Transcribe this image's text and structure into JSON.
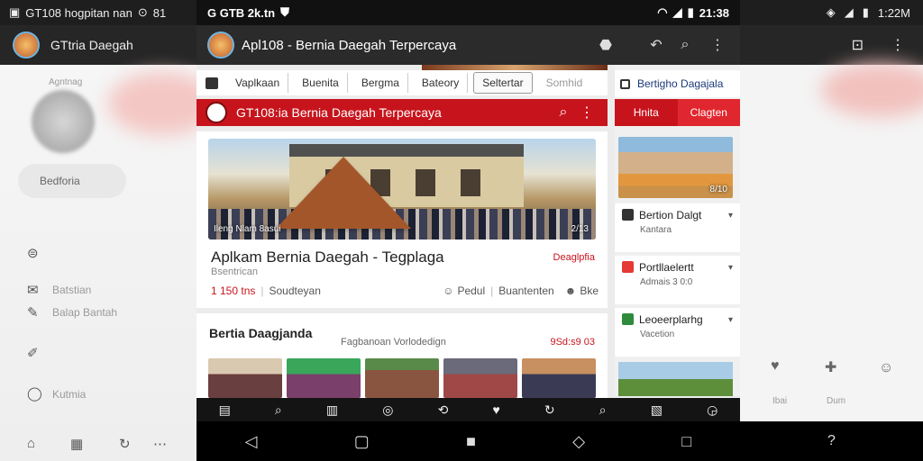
{
  "left_panel": {
    "status_text": "GT108 hogpitan nan",
    "status_right": "81",
    "app_title": "GTtria Daegah",
    "profile_label": "Agntnag",
    "button_label": "Bedforia",
    "menu": [
      "Batstian",
      "Balap Bantah",
      "Kutmia"
    ],
    "bottom_icons": [
      "home-icon",
      "image-icon",
      "refresh-icon",
      "more-icon"
    ]
  },
  "main": {
    "status": {
      "left": "G GTB 2k.tn",
      "time": "21:38"
    },
    "appbar": {
      "title": "Apl108 - Bernia Daegah Terpercaya"
    },
    "chips": [
      "Vaplkaan",
      "Buenita",
      "Bergma",
      "Bateory",
      "Seltertar",
      "Somhid"
    ],
    "selected_chip": "Seltertar",
    "redbar": {
      "title": "GT108:ia Bernia Daegah Terpercaya"
    },
    "hero": {
      "caption": "Ileng Nlam 8asui",
      "counter": "2/13"
    },
    "article": {
      "title": "Aplkam Bernia Daegah - Tegplaga",
      "tag": "Deaglpfia",
      "subtitle": "Bsentrican",
      "count": "1 150 tns",
      "source": "Soudteyan",
      "action1": "Pedul",
      "action2": "Buantenten",
      "action3": "Bke"
    },
    "section": {
      "title": "Bertia Daagjanda",
      "caption": "Fagbanoan Vorlodedign",
      "right": "9Sd:s9 03"
    },
    "bottom_bar_icons": [
      "layout-icon",
      "search-icon",
      "book-icon",
      "target-icon",
      "tag-icon",
      "heart-icon",
      "refresh-icon",
      "search-icon",
      "grid-icon",
      "chat-icon"
    ],
    "nav_icons": [
      "back-icon",
      "home-icon",
      "square-icon",
      "back-icon",
      "recent-icon"
    ]
  },
  "right_panel": {
    "header": "Bertigho Dagajala",
    "tabs": [
      "Hnita",
      "Clagten"
    ],
    "tab_colors": [
      "#c7141c",
      "#e0262e"
    ],
    "img_counter": "8/10",
    "items": [
      {
        "title": "Bertion Dalgt",
        "sub": "Kantara",
        "color": "#333333"
      },
      {
        "title": "Portllaelertt",
        "sub": "Admais 3 0:0",
        "color": "#e53935"
      },
      {
        "title": "Leoeerplarhg",
        "sub": "Vacetion",
        "color": "#2e8b3b"
      }
    ]
  },
  "far_right": {
    "status_time": "1:22M",
    "icon_labels": [
      "Ibai",
      "Dum"
    ]
  }
}
